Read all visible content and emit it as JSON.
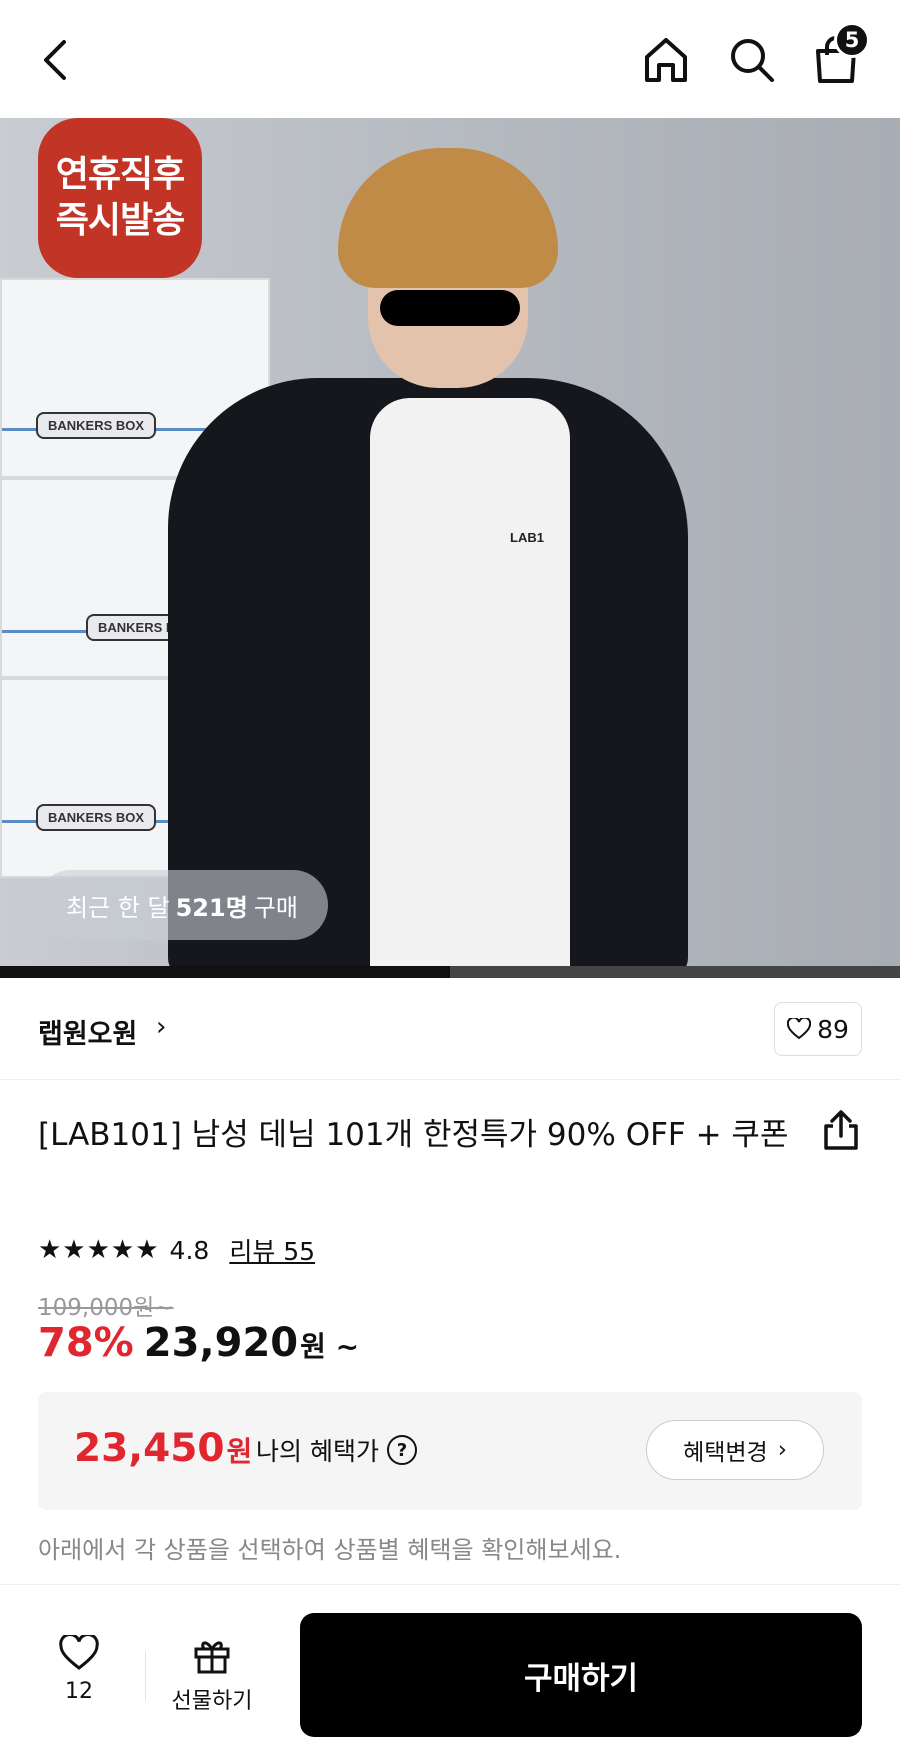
{
  "header": {
    "cart_count": "5",
    "icons": [
      "chevron-left-icon",
      "home-icon",
      "search-icon",
      "shopping-bag-icon"
    ]
  },
  "hero": {
    "promo_line1": "연휴직후",
    "promo_line2": "즉시발송",
    "buyers_prefix": "최근 한 달",
    "buyers_count": "521명",
    "buyers_suffix": "구매",
    "box_label": "BANKERS BOX",
    "shirt_logo": "LAB1",
    "carousel_progress": 0.5,
    "promo_color": "#c23425"
  },
  "brand": {
    "name": "랩원오원",
    "chevron": "›",
    "likes": "89"
  },
  "product": {
    "title": "[LAB101] 남성 데님 101개 한정특가 90% OFF + 쿠폰",
    "rating": "4.8",
    "stars": 5,
    "review_label": "리뷰 55",
    "original_price": "109,000원~",
    "discount": "78%",
    "price": "23,920",
    "price_unit": "원 ~",
    "accent_color": "#e0262f"
  },
  "benefit": {
    "price": "23,450",
    "price_unit": "원",
    "label": "나의 혜택가",
    "question": "?",
    "change_label": "혜택변경",
    "change_chevron": "›",
    "hint": "아래에서 각 상품을 선택하여 상품별 혜택을 확인해보세요."
  },
  "bottom": {
    "wish_count": "12",
    "gift_label": "선물하기",
    "buy_label": "구매하기"
  }
}
